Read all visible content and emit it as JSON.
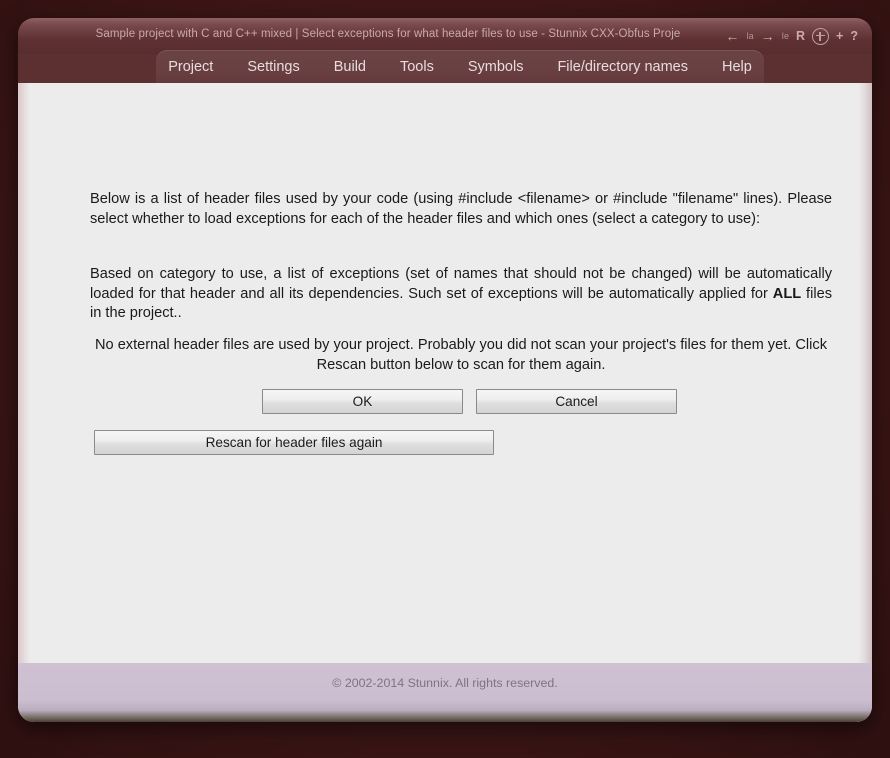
{
  "window": {
    "title": "Sample project with C and C++ mixed | Select exceptions for what header files to use - Stunnix CXX-Obfus Proje",
    "title_tools": [
      {
        "name": "back-arrow-icon",
        "glyph": "←",
        "kind": "arrow"
      },
      {
        "name": "back-label-icon",
        "glyph": "ǀa",
        "kind": "tiny"
      },
      {
        "name": "forward-arrow-icon",
        "glyph": "→",
        "kind": "arrow"
      },
      {
        "name": "forward-label-icon",
        "glyph": "ǀe",
        "kind": "tiny"
      },
      {
        "name": "reload-icon",
        "glyph": "R",
        "kind": "letter"
      },
      {
        "name": "zoom-circle-plus-icon",
        "glyph": "",
        "kind": "circle"
      },
      {
        "name": "plus-icon",
        "glyph": "+",
        "kind": "letter"
      },
      {
        "name": "help-question-icon",
        "glyph": "?",
        "kind": "letter"
      }
    ]
  },
  "menu": {
    "items": [
      {
        "label": "Project"
      },
      {
        "label": "Settings"
      },
      {
        "label": "Build"
      },
      {
        "label": "Tools"
      },
      {
        "label": "Symbols"
      },
      {
        "label": "File/directory names"
      },
      {
        "label": "Help"
      }
    ]
  },
  "main": {
    "paragraph_1": "Below is a list of header files used by your code (using #include <filename> or #include \"filename\" lines). Please select whether to load exceptions for each of the header files and which ones (select a category to use):",
    "paragraph_2_part_1": "Based on category to use, a list of exceptions (set of names that should not be changed) will be automatically loaded for that header and all its dependencies. Such set of exceptions will be automatically applied for ",
    "paragraph_2_bold": "ALL",
    "paragraph_2_part_2": " files in the project..",
    "paragraph_3": "No external header files are used by your project. Probably you did not scan your project's files for them yet. Click Rescan button below to scan for them again.",
    "buttons": {
      "ok": "OK",
      "cancel": "Cancel",
      "rescan": "Rescan for header files again"
    }
  },
  "footer": {
    "copyright": "© 2002-2014 Stunnix. All rights reserved."
  },
  "colors": {
    "desktop": "#3d1616",
    "title_bar": "#5e3133",
    "menu_bar": "#6a4143",
    "content": "#edecec",
    "footer": "#ccbed0",
    "text": "#1a1a1a",
    "title_text": "#c9a9ab",
    "footer_text": "#7e7482"
  }
}
